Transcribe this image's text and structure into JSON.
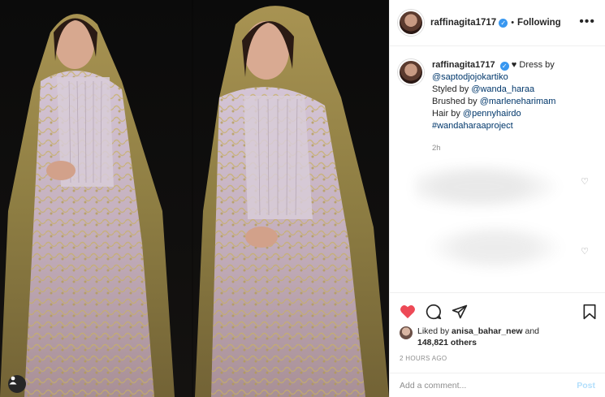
{
  "header": {
    "username": "raffinagita1717",
    "separator": "•",
    "follow_status": "Following",
    "more_icon": "more-options-icon"
  },
  "caption": {
    "username": "raffinagita1717",
    "heart": "♥",
    "line1_prefix": "Dress by",
    "line2": "@saptodjojokartiko",
    "line3_prefix": "Styled by ",
    "line3_link": "@wanda_haraa",
    "line4_prefix": "Brushed by ",
    "line4_link": "@marleneharimam",
    "line5_prefix": "Hair by ",
    "line5_link": "@pennyhairdo",
    "line6": "#wandaharaaproject",
    "ago": "2h"
  },
  "likes": {
    "prefix": "Liked by ",
    "user": "anisa_bahar_new",
    "mid": " and",
    "count": "148,821 others"
  },
  "timestamp": "2 HOURS AGO",
  "comment": {
    "placeholder": "Add a comment...",
    "post_label": "Post"
  },
  "colors": {
    "like_red": "#ed4956",
    "link_blue": "#00376b",
    "verified_blue": "#3897f0"
  }
}
